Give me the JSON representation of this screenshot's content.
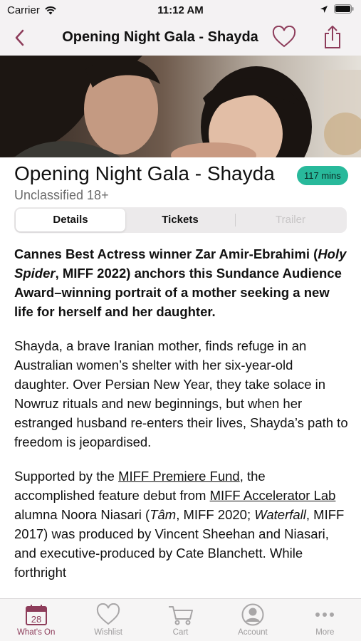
{
  "status_bar": {
    "carrier": "Carrier",
    "time": "11:12 AM"
  },
  "nav": {
    "title": "Opening Night Gala - Shayda"
  },
  "film": {
    "title": "Opening Night Gala - Shayda",
    "duration": "117 mins",
    "classification": "Unclassified 18+"
  },
  "segments": {
    "details": "Details",
    "tickets": "Tickets",
    "trailer": "Trailer"
  },
  "description": {
    "lead_1": "Cannes Best Actress winner Zar Amir-Ebrahimi (",
    "lead_italic": "Holy Spider",
    "lead_2": ", MIFF 2022) anchors this Sundance Audience Award–winning portrait of a mother seeking a new life for herself and her daughter.",
    "para_2": "Shayda, a brave Iranian mother, finds refuge in an Australian women’s shelter with her six-year-old daughter. Over Persian New Year, they take solace in Nowruz rituals and new beginnings, but when her estranged husband re-enters their lives, Shayda’s path to freedom is jeopardised.",
    "p3_1": "Supported by the ",
    "p3_link_1": "MIFF Premiere Fund",
    "p3_2": ", the accomplished feature debut from ",
    "p3_link_2": "MIFF Accelerator Lab",
    "p3_3": " alumna Noora Niasari (",
    "p3_italic_1": "Tâm",
    "p3_4": ", MIFF 2020; ",
    "p3_italic_2": "Waterfall",
    "p3_5": ", MIFF 2017) was produced by Vincent Sheehan and Niasari, and executive-produced by Cate Blanchett. While forthright"
  },
  "tabs": [
    {
      "label": "What's On",
      "icon": "calendar-icon",
      "badge": "28"
    },
    {
      "label": "Wishlist",
      "icon": "heart-icon"
    },
    {
      "label": "Cart",
      "icon": "cart-icon"
    },
    {
      "label": "Account",
      "icon": "account-icon"
    },
    {
      "label": "More",
      "icon": "more-icon"
    }
  ],
  "colors": {
    "accent": "#8d3c5a",
    "badge": "#28b99b",
    "inactive": "#9e9c9d"
  }
}
